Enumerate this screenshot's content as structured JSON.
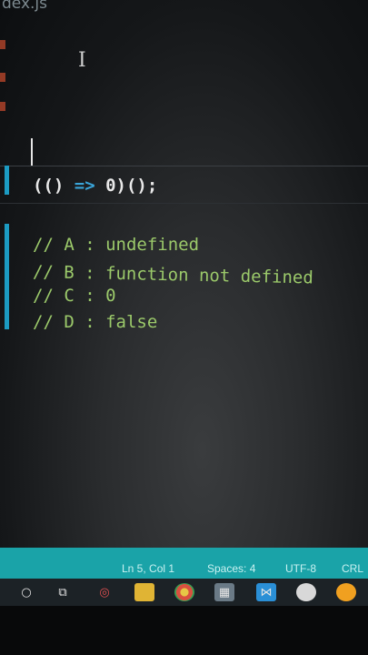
{
  "editor": {
    "tab_title": "dex.js",
    "code_line": {
      "open": "(() ",
      "arrow": "=>",
      "close": " 0)();"
    },
    "comments": [
      "// A : undefined",
      "// B : function not defined",
      "// C : 0",
      "// D : false"
    ]
  },
  "statusbar": {
    "position": "Ln 5, Col 1",
    "spaces": "Spaces: 4",
    "encoding": "UTF-8",
    "eol": "CRL",
    "color": "#1aa3a8"
  },
  "taskbar": {
    "icons": [
      "search-icon",
      "task-view-icon",
      "opera-icon",
      "folder-icon",
      "chrome-icon",
      "photos-icon",
      "vscode-icon",
      "app-icon",
      "app-icon"
    ]
  },
  "colors": {
    "comment": "#9bc96a",
    "arrow": "#3aa5d9",
    "change_bar": "#1c9bc2"
  }
}
